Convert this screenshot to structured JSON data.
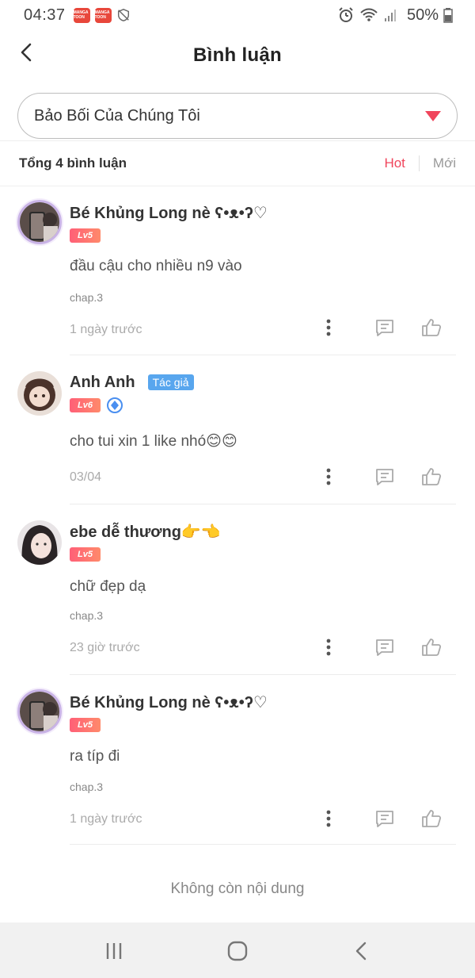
{
  "status_bar": {
    "time": "04:37",
    "apps": [
      {
        "icon": "mangatoon-app-icon",
        "label": "MANGA TOON"
      },
      {
        "icon": "mangatoon-app-icon",
        "label": "MANGA TOON"
      }
    ],
    "battery": "50%"
  },
  "header": {
    "title": "Bình luận"
  },
  "selector": {
    "value": "Bảo Bối Của Chúng Tôi"
  },
  "comments_meta": {
    "total": "Tổng 4 bình luận",
    "tabs": [
      {
        "label": "Hot",
        "active": true
      },
      {
        "label": "Mới",
        "active": false
      }
    ]
  },
  "comments": [
    {
      "name": "Bé Khủng Long nè ʕ•ᴥ•ʔ♡",
      "level": "Lv5",
      "text": "đầu cậu cho  nhiều n9 vào",
      "chapter": "chap.3",
      "time": "1 ngày trước"
    },
    {
      "name": "Anh Anh",
      "author_tag": "Tác giả",
      "level": "Lv6",
      "text": "cho tui xin 1 like nhó😊😊",
      "time": "03/04"
    },
    {
      "name": "ebe dễ thương👉👈",
      "level": "Lv5",
      "text": "chữ đẹp dạ",
      "chapter": "chap.3",
      "time": "23 giờ trước"
    },
    {
      "name": "Bé Khủng Long nè ʕ•ᴥ•ʔ♡",
      "level": "Lv5",
      "text": "ra típ đi",
      "chapter": "chap.3",
      "time": "1 ngày trước"
    }
  ],
  "footer": {
    "end_text": "Không còn nội dung"
  },
  "colors": {
    "accent": "#f0455c",
    "author_tag": "#58a6ee"
  }
}
